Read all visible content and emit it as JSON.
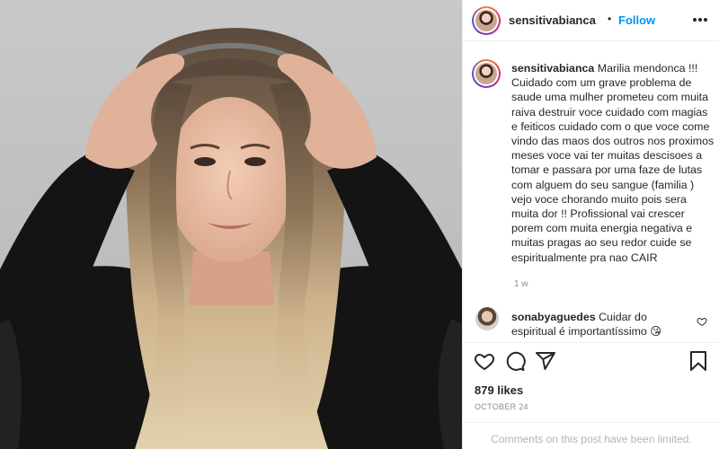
{
  "post": {
    "username": "sensitivabianca",
    "dot": "•",
    "follow_label": "Follow",
    "more_icon": "more-horizontal-icon",
    "caption": {
      "username": "sensitivabianca",
      "text": "Marilia mendonca !!! Cuidado com um grave problema de saude uma mulher prometeu com muita raiva destruir voce cuidado com magias e feiticos cuidado com o que voce come vindo das maos dos outros nos proximos meses voce vai ter muitas descisoes a tomar e passara por uma faze de lutas com alguem do seu sangue (familia ) vejo voce chorando muito pois sera muita dor !! Profissional vai crescer porem com muita energia negativa e muitas pragas ao seu redor cuide se espiritualmente pra nao CAIR",
      "time": "1 w"
    },
    "comment": {
      "username": "sonabyaguedes",
      "text": "Cuidar do espiritual é importantíssimo 😘"
    },
    "likes": "879 likes",
    "date": "October 24",
    "limited_notice": "Comments on this post have been limited."
  },
  "icons": {
    "like": "heart-icon",
    "comment": "comment-icon",
    "share": "share-icon",
    "save": "bookmark-icon"
  },
  "colors": {
    "follow": "#0095f6",
    "muted": "#8e8e8e",
    "border": "#efefef"
  }
}
